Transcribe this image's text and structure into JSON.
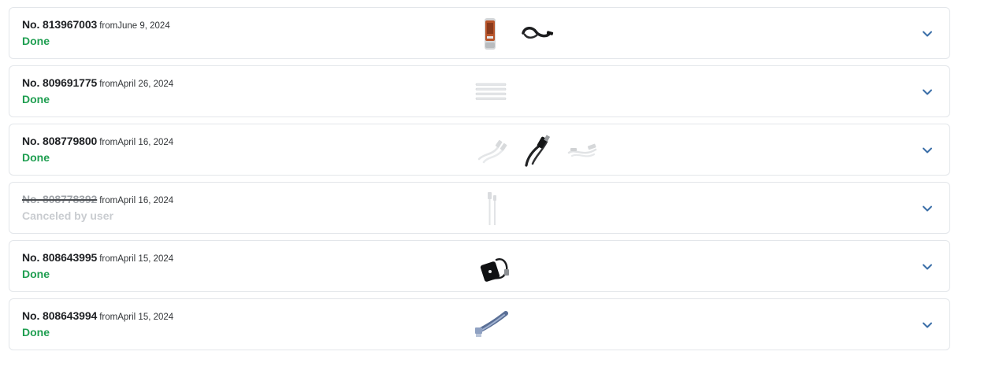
{
  "orders": [
    {
      "number": "No. 813967003",
      "date": "fromJune 9, 2024",
      "status": "Done",
      "status_type": "done",
      "thumbnails": [
        {
          "name": "product-thumbnail-battery-pack",
          "icon": "battery-pack-icon"
        },
        {
          "name": "product-thumbnail-black-cable",
          "icon": "black-cable-icon"
        }
      ]
    },
    {
      "number": "No. 809691775",
      "date": "fromApril 26, 2024",
      "status": "Done",
      "status_type": "done",
      "thumbnails": [
        {
          "name": "product-thumbnail-cable-ties",
          "icon": "cable-ties-icon"
        }
      ]
    },
    {
      "number": "No. 808779800",
      "date": "fromApril 16, 2024",
      "status": "Done",
      "status_type": "done",
      "thumbnails": [
        {
          "name": "product-thumbnail-white-usb-cable",
          "icon": "white-usb-cable-icon"
        },
        {
          "name": "product-thumbnail-black-usb-cable",
          "icon": "black-usb-cable-icon"
        },
        {
          "name": "product-thumbnail-white-micro-usb-cable",
          "icon": "white-micro-usb-cable-icon"
        }
      ]
    },
    {
      "number": "No. 808778392",
      "date": "fromApril 16, 2024",
      "status": "Canceled by user",
      "status_type": "canceled",
      "thumbnails": [
        {
          "name": "product-thumbnail-white-lightning-cable",
          "icon": "white-lightning-cable-icon"
        }
      ]
    },
    {
      "number": "No. 808643995",
      "date": "fromApril 15, 2024",
      "status": "Done",
      "status_type": "done",
      "thumbnails": [
        {
          "name": "product-thumbnail-usb-sound-card",
          "icon": "usb-sound-card-icon"
        }
      ]
    },
    {
      "number": "No. 808643994",
      "date": "fromApril 15, 2024",
      "status": "Done",
      "status_type": "done",
      "thumbnails": [
        {
          "name": "product-thumbnail-usb-hub",
          "icon": "usb-hub-icon"
        }
      ]
    }
  ],
  "expand_icon": "chevron-down-icon",
  "colors": {
    "status_done": "#1e9e50",
    "status_canceled": "#c9ccd0",
    "chevron": "#3b6fa8",
    "card_border": "#e3e6ea"
  }
}
